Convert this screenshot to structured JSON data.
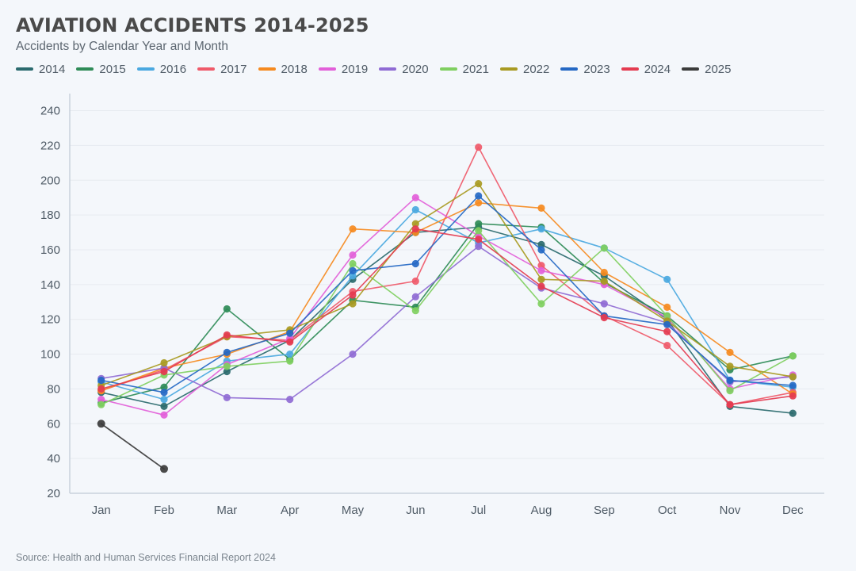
{
  "header": {
    "title": "AVIATION ACCIDENTS 2014-2025",
    "subtitle": "Accidents by Calendar Year and Month"
  },
  "source": {
    "text": "Source: Health and Human Services Financial Report 2024"
  },
  "colors": {
    "background": "#f4f7fb",
    "title": "#4a4a4a",
    "subtitle": "#5c6670",
    "axis_text": "#4f5b66",
    "gridline": "#e7ebf0",
    "axis_line": "#c9d2dc",
    "source_text": "#7b858e"
  },
  "chart_data": {
    "type": "line",
    "title": "AVIATION ACCIDENTS 2014-2025",
    "subtitle": "Accidents by Calendar Year and Month",
    "xlabel": "",
    "ylabel": "",
    "categories": [
      "Jan",
      "Feb",
      "Mar",
      "Apr",
      "May",
      "Jun",
      "Jul",
      "Aug",
      "Sep",
      "Oct",
      "Nov",
      "Dec"
    ],
    "ylim": [
      20,
      248
    ],
    "yticks": [
      20,
      40,
      60,
      80,
      100,
      120,
      140,
      160,
      180,
      200,
      220,
      240
    ],
    "grid": true,
    "legend_position": "top",
    "markers": true,
    "series": [
      {
        "name": "2014",
        "color": "#2a6a6e",
        "values": [
          78,
          70,
          90,
          108,
          143,
          170,
          173,
          163,
          145,
          120,
          70,
          66
        ]
      },
      {
        "name": "2015",
        "color": "#2e8b57",
        "values": [
          72,
          81,
          126,
          97,
          131,
          127,
          175,
          173,
          141,
          122,
          91,
          99
        ]
      },
      {
        "name": "2016",
        "color": "#4aa8e0",
        "values": [
          84,
          74,
          96,
          100,
          145,
          183,
          164,
          172,
          161,
          143,
          85,
          81
        ]
      },
      {
        "name": "2017",
        "color": "#ef5a6a",
        "values": [
          79,
          91,
          110,
          108,
          136,
          142,
          219,
          151,
          122,
          105,
          71,
          78
        ]
      },
      {
        "name": "2018",
        "color": "#f58a1f",
        "values": [
          79,
          92,
          100,
          113,
          172,
          170,
          187,
          184,
          147,
          127,
          101,
          77
        ]
      },
      {
        "name": "2019",
        "color": "#e25fd9",
        "values": [
          74,
          65,
          94,
          109,
          157,
          190,
          168,
          148,
          140,
          121,
          80,
          88
        ]
      },
      {
        "name": "2020",
        "color": "#8f6bd4",
        "values": [
          86,
          92,
          75,
          74,
          100,
          133,
          162,
          138,
          129,
          118,
          84,
          87
        ]
      },
      {
        "name": "2021",
        "color": "#7fcf60",
        "values": [
          71,
          88,
          93,
          96,
          152,
          125,
          171,
          129,
          161,
          122,
          79,
          99
        ]
      },
      {
        "name": "2022",
        "color": "#a89a22",
        "values": [
          82,
          95,
          110,
          114,
          129,
          175,
          198,
          143,
          142,
          119,
          93,
          87
        ]
      },
      {
        "name": "2023",
        "color": "#2468c4",
        "values": [
          85,
          78,
          101,
          112,
          148,
          152,
          191,
          160,
          122,
          117,
          85,
          82
        ]
      },
      {
        "name": "2024",
        "color": "#e43b50",
        "values": [
          80,
          90,
          111,
          107,
          134,
          172,
          166,
          139,
          121,
          113,
          71,
          76
        ]
      },
      {
        "name": "2025",
        "color": "#3b3b3b",
        "values": [
          60,
          34,
          null,
          null,
          null,
          null,
          null,
          null,
          null,
          null,
          null,
          null
        ]
      }
    ]
  }
}
